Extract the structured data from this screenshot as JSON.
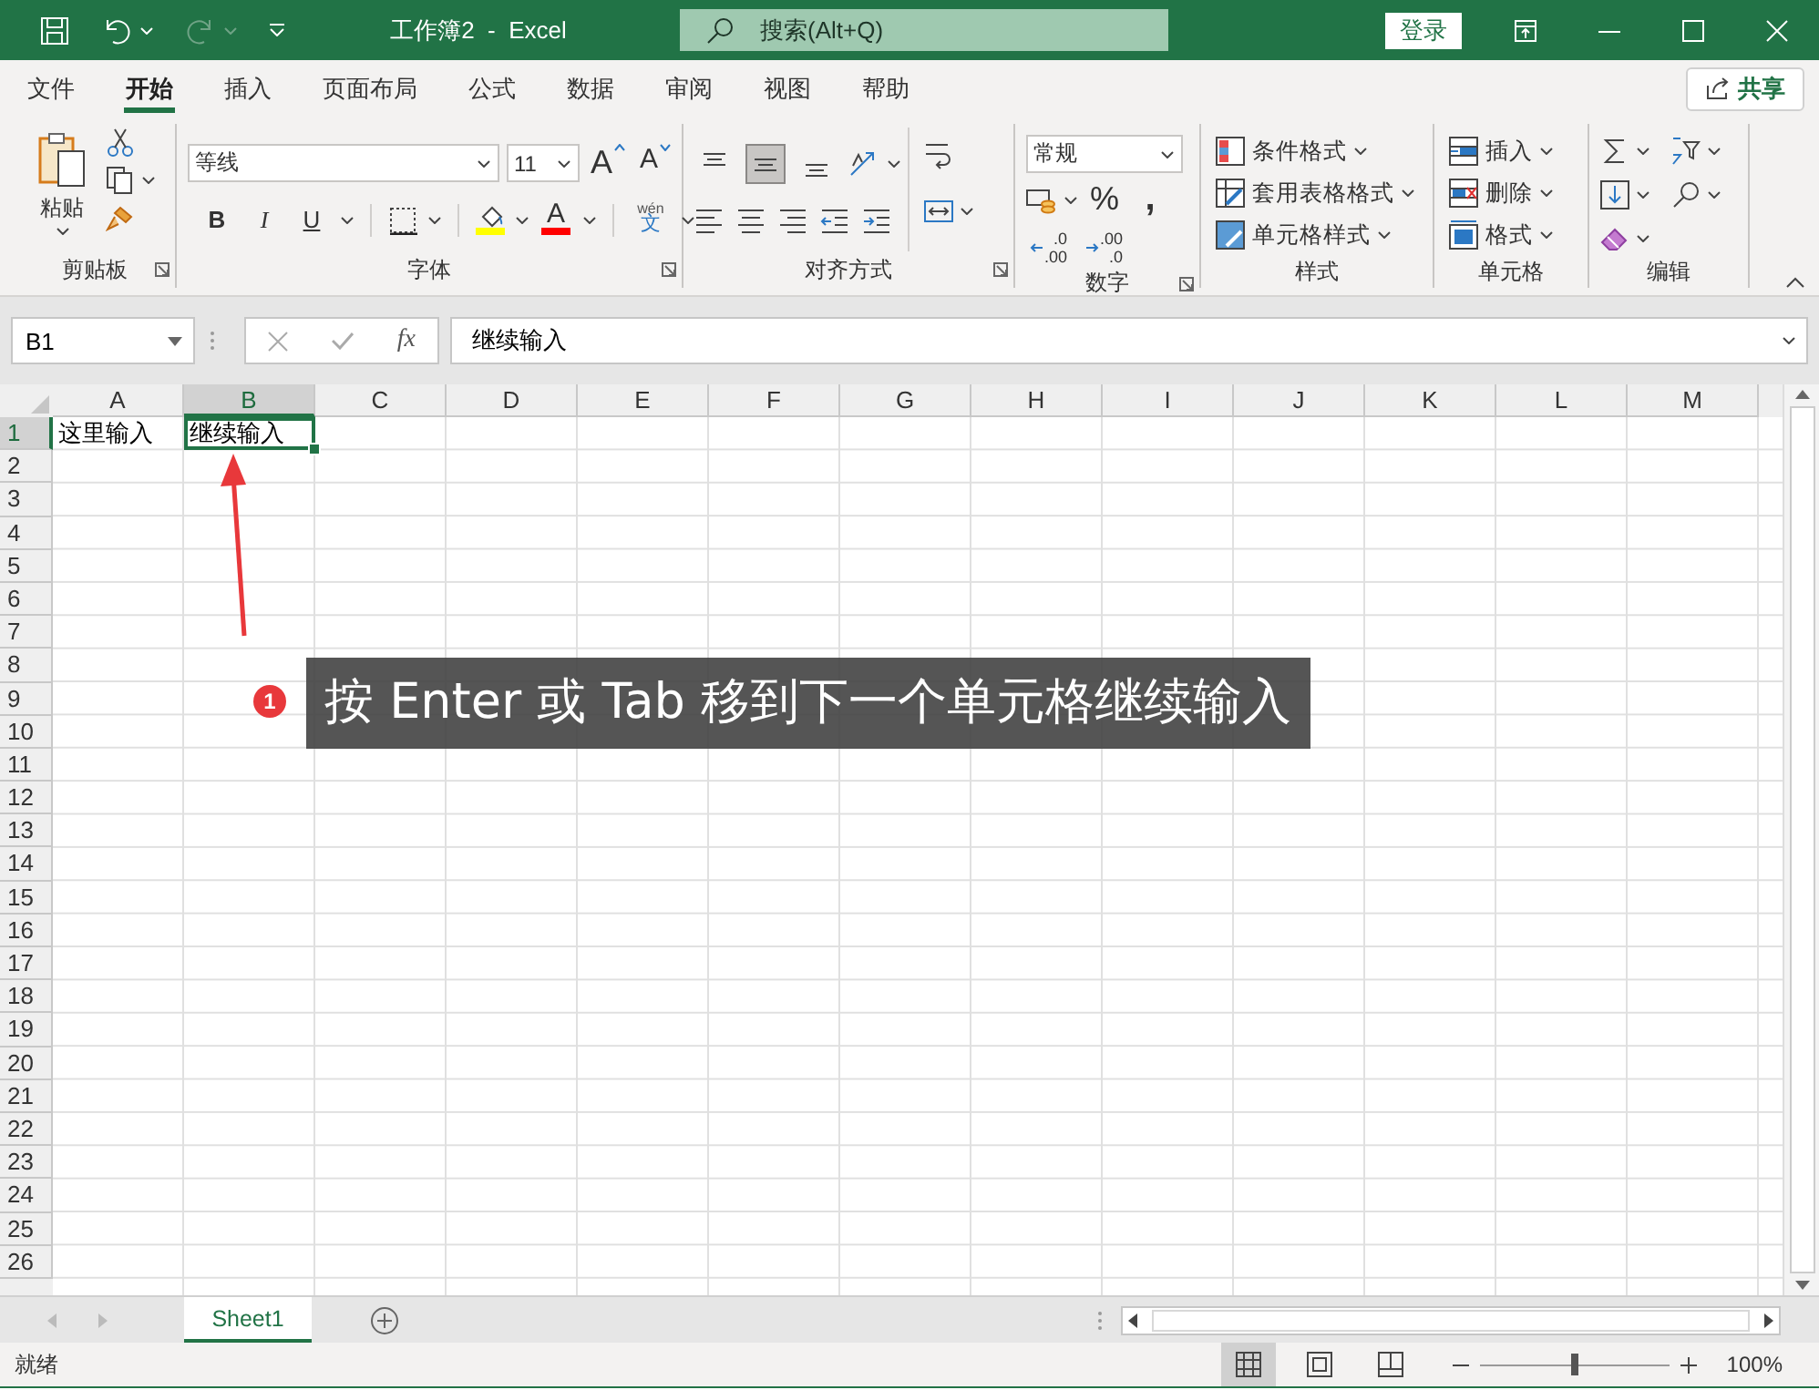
{
  "window": {
    "title": "工作簿2  -  Excel",
    "search_placeholder": "搜索(Alt+Q)",
    "sign_in": "登录"
  },
  "menu_tabs": [
    {
      "label": "文件",
      "selected": false
    },
    {
      "label": "开始",
      "selected": true
    },
    {
      "label": "插入",
      "selected": false
    },
    {
      "label": "页面布局",
      "selected": false
    },
    {
      "label": "公式",
      "selected": false
    },
    {
      "label": "数据",
      "selected": false
    },
    {
      "label": "审阅",
      "selected": false
    },
    {
      "label": "视图",
      "selected": false
    },
    {
      "label": "帮助",
      "selected": false
    }
  ],
  "share": "共享",
  "ribbon": {
    "groups": [
      {
        "kind": "clipboard",
        "label": "剪贴板",
        "launcher": true,
        "paste": "粘贴"
      },
      {
        "kind": "font",
        "label": "字体",
        "launcher": true,
        "font_name": "等线",
        "font_size": "11",
        "size_buttons": [
          {
            "kind": "grow",
            "label": "A"
          },
          {
            "kind": "shrink",
            "label": "A"
          }
        ],
        "styles": [
          "B",
          "I",
          "U"
        ],
        "font_color": "A",
        "phonetic": {
          "pinyin": "wén",
          "character": "文"
        }
      },
      {
        "kind": "alignment",
        "label": "对齐方式",
        "launcher": true,
        "vertical_align": [
          {
            "selected": false
          },
          {
            "selected": true
          },
          {
            "selected": false
          }
        ]
      },
      {
        "kind": "number",
        "label": "数字",
        "launcher": true,
        "format": "常规",
        "symbols": [
          "%",
          ","
        ],
        "decimal_buttons": [
          [
            ".0",
            ".00"
          ],
          [
            ".00",
            ".0"
          ]
        ]
      },
      {
        "kind": "styles",
        "label": "样式",
        "launcher": false,
        "items": [
          "条件格式",
          "套用表格格式",
          "单元格样式"
        ]
      },
      {
        "kind": "cells",
        "label": "单元格",
        "launcher": false,
        "items": [
          "插入",
          "删除",
          "格式"
        ]
      },
      {
        "kind": "editing",
        "label": "编辑",
        "launcher": false
      }
    ]
  },
  "formula_bar": {
    "name_box": "B1",
    "insert_function": "fx",
    "formula": "继续输入"
  },
  "sheet": {
    "columns": [
      {
        "label": "A",
        "selected": false
      },
      {
        "label": "B",
        "selected": true
      },
      {
        "label": "C",
        "selected": false
      },
      {
        "label": "D",
        "selected": false
      },
      {
        "label": "E",
        "selected": false
      },
      {
        "label": "F",
        "selected": false
      },
      {
        "label": "G",
        "selected": false
      },
      {
        "label": "H",
        "selected": false
      },
      {
        "label": "I",
        "selected": false
      },
      {
        "label": "J",
        "selected": false
      },
      {
        "label": "K",
        "selected": false
      },
      {
        "label": "L",
        "selected": false
      },
      {
        "label": "M",
        "selected": false
      }
    ],
    "rows": [
      {
        "header": "1",
        "selected": true,
        "cells": [
          {
            "text": "这里输入",
            "selected": false
          },
          {
            "text": "继续输入",
            "selected": true
          }
        ]
      },
      {
        "header": "2",
        "selected": false
      },
      {
        "header": "3",
        "selected": false
      },
      {
        "header": "4",
        "selected": false
      },
      {
        "header": "5",
        "selected": false
      },
      {
        "header": "6",
        "selected": false
      },
      {
        "header": "7",
        "selected": false
      },
      {
        "header": "8",
        "selected": false
      },
      {
        "header": "9",
        "selected": false
      },
      {
        "header": "10",
        "selected": false
      },
      {
        "header": "11",
        "selected": false
      },
      {
        "header": "12",
        "selected": false
      },
      {
        "header": "13",
        "selected": false
      },
      {
        "header": "14",
        "selected": false
      },
      {
        "header": "15",
        "selected": false
      },
      {
        "header": "16",
        "selected": false
      },
      {
        "header": "17",
        "selected": false
      },
      {
        "header": "18",
        "selected": false
      },
      {
        "header": "19",
        "selected": false
      },
      {
        "header": "20",
        "selected": false
      },
      {
        "header": "21",
        "selected": false
      },
      {
        "header": "22",
        "selected": false
      },
      {
        "header": "23",
        "selected": false
      },
      {
        "header": "24",
        "selected": false
      },
      {
        "header": "25",
        "selected": false
      },
      {
        "header": "26",
        "selected": false
      }
    ]
  },
  "annotation": {
    "number": "1",
    "text": "按 Enter 或 Tab 移到下一个单元格继续输入"
  },
  "sheet_tabs": [
    {
      "label": "Sheet1",
      "selected": true
    }
  ],
  "status_bar": {
    "status": "就绪",
    "views": [
      {
        "selected": true
      },
      {
        "selected": false
      },
      {
        "selected": false
      }
    ],
    "zoom_slider": {
      "level": 0.5
    },
    "zoom": "100%"
  }
}
